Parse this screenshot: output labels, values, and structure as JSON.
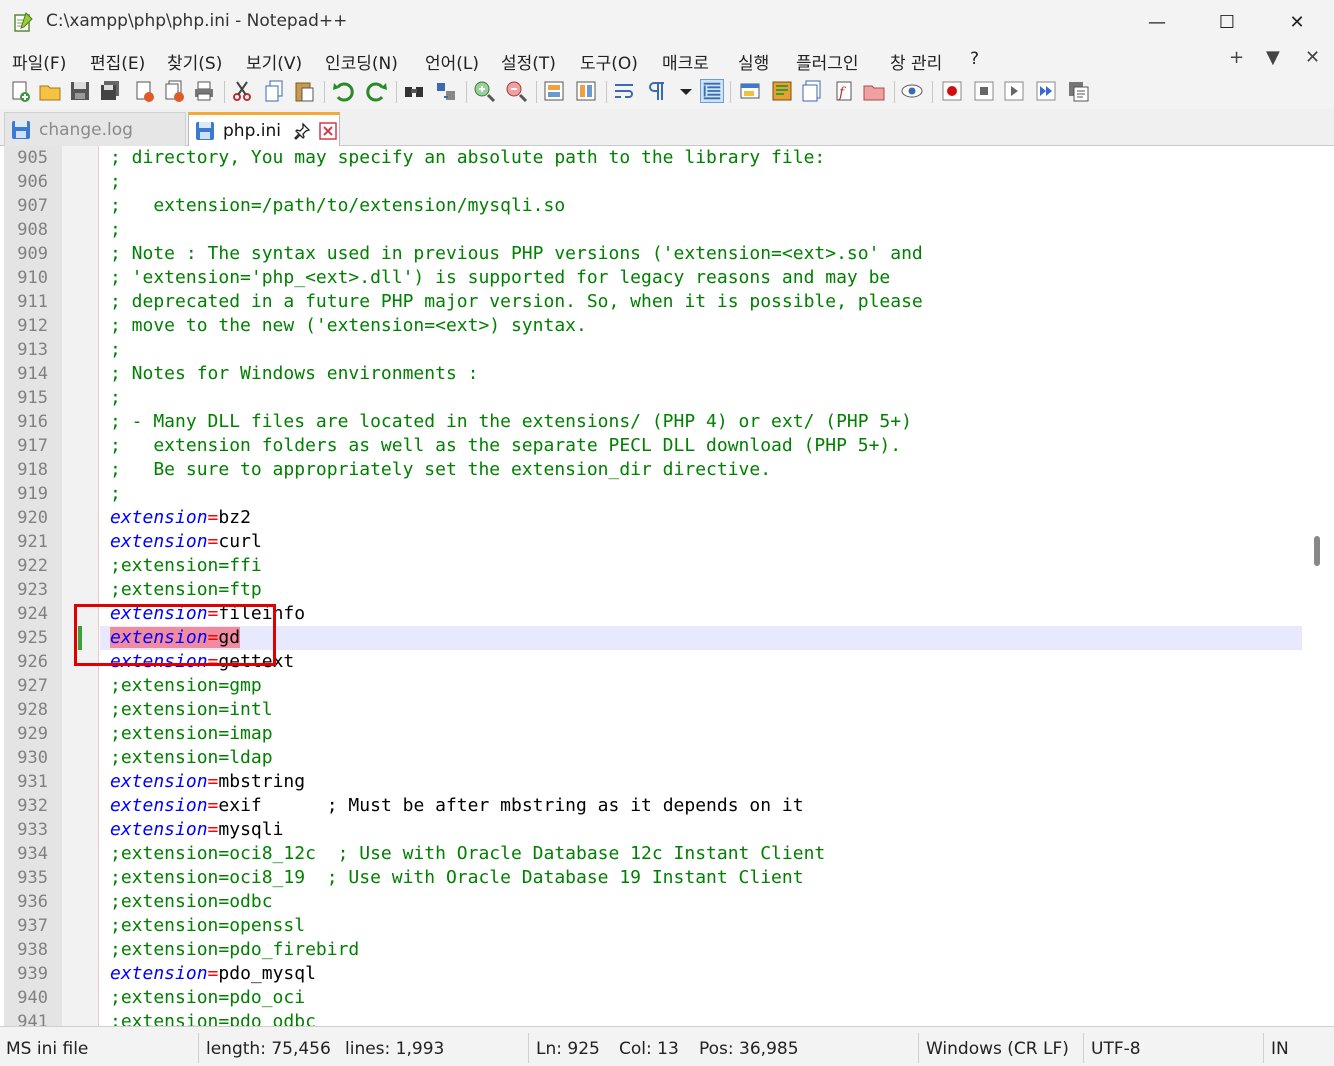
{
  "window": {
    "title": "C:\\xampp\\php\\php.ini - Notepad++",
    "minimize": "—",
    "maximize": "☐",
    "close": "✕"
  },
  "menu": {
    "items": [
      "파일(F)",
      "편집(E)",
      "찾기(S)",
      "보기(V)",
      "인코딩(N)",
      "언어(L)",
      "설정(T)",
      "도구(O)",
      "매크로",
      "실행",
      "플러그인",
      "창 관리",
      "?"
    ],
    "right": [
      "+",
      "▼",
      "✕"
    ]
  },
  "tabs": [
    {
      "label": "change.log",
      "active": false
    },
    {
      "label": "php.ini",
      "active": true,
      "pin": "📌",
      "close": "✕"
    }
  ],
  "editor": {
    "current_line": "925",
    "lines": [
      {
        "n": "905",
        "parts": [
          {
            "t": "; directory, You may specify an absolute path to the library file:",
            "k": "comment"
          }
        ]
      },
      {
        "n": "906",
        "parts": [
          {
            "t": ";",
            "k": "comment"
          }
        ]
      },
      {
        "n": "907",
        "parts": [
          {
            "t": ";   extension=/path/to/extension/mysqli.so",
            "k": "comment"
          }
        ]
      },
      {
        "n": "908",
        "parts": [
          {
            "t": ";",
            "k": "comment"
          }
        ]
      },
      {
        "n": "909",
        "parts": [
          {
            "t": "; Note : The syntax used in previous PHP versions ('extension=<ext>.so' and",
            "k": "comment"
          }
        ]
      },
      {
        "n": "910",
        "parts": [
          {
            "t": "; 'extension='php_<ext>.dll') is supported for legacy reasons and may be",
            "k": "comment"
          }
        ]
      },
      {
        "n": "911",
        "parts": [
          {
            "t": "; deprecated in a future PHP major version. So, when it is possible, please",
            "k": "comment"
          }
        ]
      },
      {
        "n": "912",
        "parts": [
          {
            "t": "; move to the new ('extension=<ext>) syntax.",
            "k": "comment"
          }
        ]
      },
      {
        "n": "913",
        "parts": [
          {
            "t": ";",
            "k": "comment"
          }
        ]
      },
      {
        "n": "914",
        "parts": [
          {
            "t": "; Notes for Windows environments :",
            "k": "comment"
          }
        ]
      },
      {
        "n": "915",
        "parts": [
          {
            "t": ";",
            "k": "comment"
          }
        ]
      },
      {
        "n": "916",
        "parts": [
          {
            "t": "; - Many DLL files are located in the extensions/ (PHP 4) or ext/ (PHP 5+)",
            "k": "comment"
          }
        ]
      },
      {
        "n": "917",
        "parts": [
          {
            "t": ";   extension folders as well as the separate PECL DLL download (PHP 5+).",
            "k": "comment"
          }
        ]
      },
      {
        "n": "918",
        "parts": [
          {
            "t": ";   Be sure to appropriately set the extension_dir directive.",
            "k": "comment"
          }
        ]
      },
      {
        "n": "919",
        "parts": [
          {
            "t": ";",
            "k": "comment"
          }
        ]
      },
      {
        "n": "920",
        "parts": [
          {
            "t": "extension",
            "k": "key"
          },
          {
            "t": "=",
            "k": "eq"
          },
          {
            "t": "bz2",
            "k": "val"
          }
        ]
      },
      {
        "n": "921",
        "parts": [
          {
            "t": "extension",
            "k": "key"
          },
          {
            "t": "=",
            "k": "eq"
          },
          {
            "t": "curl",
            "k": "val"
          }
        ]
      },
      {
        "n": "922",
        "parts": [
          {
            "t": ";extension=ffi",
            "k": "comment"
          }
        ]
      },
      {
        "n": "923",
        "parts": [
          {
            "t": ";extension=ftp",
            "k": "comment"
          }
        ]
      },
      {
        "n": "924",
        "parts": [
          {
            "t": "extension",
            "k": "key"
          },
          {
            "t": "=",
            "k": "eq"
          },
          {
            "t": "fileinfo",
            "k": "val"
          }
        ]
      },
      {
        "n": "925",
        "parts": [
          {
            "t": "extension",
            "k": "key"
          },
          {
            "t": "=",
            "k": "eq"
          },
          {
            "t": "gd",
            "k": "val"
          }
        ],
        "selected": true
      },
      {
        "n": "926",
        "parts": [
          {
            "t": "extension",
            "k": "key"
          },
          {
            "t": "=",
            "k": "eq"
          },
          {
            "t": "gettext",
            "k": "val"
          }
        ]
      },
      {
        "n": "927",
        "parts": [
          {
            "t": ";extension=gmp",
            "k": "comment"
          }
        ]
      },
      {
        "n": "928",
        "parts": [
          {
            "t": ";extension=intl",
            "k": "comment"
          }
        ]
      },
      {
        "n": "929",
        "parts": [
          {
            "t": ";extension=imap",
            "k": "comment"
          }
        ]
      },
      {
        "n": "930",
        "parts": [
          {
            "t": ";extension=ldap",
            "k": "comment"
          }
        ]
      },
      {
        "n": "931",
        "parts": [
          {
            "t": "extension",
            "k": "key"
          },
          {
            "t": "=",
            "k": "eq"
          },
          {
            "t": "mbstring",
            "k": "val"
          }
        ]
      },
      {
        "n": "932",
        "parts": [
          {
            "t": "extension",
            "k": "key"
          },
          {
            "t": "=",
            "k": "eq"
          },
          {
            "t": "exif      ; Must be after mbstring as it depends on it",
            "k": "val"
          }
        ]
      },
      {
        "n": "933",
        "parts": [
          {
            "t": "extension",
            "k": "key"
          },
          {
            "t": "=",
            "k": "eq"
          },
          {
            "t": "mysqli",
            "k": "val"
          }
        ]
      },
      {
        "n": "934",
        "parts": [
          {
            "t": ";extension=oci8_12c  ; Use with Oracle Database 12c Instant Client",
            "k": "comment"
          }
        ]
      },
      {
        "n": "935",
        "parts": [
          {
            "t": ";extension=oci8_19  ; Use with Oracle Database 19 Instant Client",
            "k": "comment"
          }
        ]
      },
      {
        "n": "936",
        "parts": [
          {
            "t": ";extension=odbc",
            "k": "comment"
          }
        ]
      },
      {
        "n": "937",
        "parts": [
          {
            "t": ";extension=openssl",
            "k": "comment"
          }
        ]
      },
      {
        "n": "938",
        "parts": [
          {
            "t": ";extension=pdo_firebird",
            "k": "comment"
          }
        ]
      },
      {
        "n": "939",
        "parts": [
          {
            "t": "extension",
            "k": "key"
          },
          {
            "t": "=",
            "k": "eq"
          },
          {
            "t": "pdo_mysql",
            "k": "val"
          }
        ]
      },
      {
        "n": "940",
        "parts": [
          {
            "t": ";extension=pdo_oci",
            "k": "comment"
          }
        ]
      },
      {
        "n": "941",
        "parts": [
          {
            "t": ";extension=pdo_odbc",
            "k": "comment"
          }
        ]
      }
    ]
  },
  "status": {
    "file_type": "MS ini file",
    "length": "length: 75,456",
    "lines": "lines: 1,993",
    "ln": "Ln: 925",
    "col": "Col: 13",
    "pos": "Pos: 36,985",
    "eol": "Windows (CR LF)",
    "encoding": "UTF-8",
    "mode": "IN"
  },
  "colors": {
    "comment": "#008000",
    "key": "#0000ff",
    "eq": "#ff0000",
    "current_line": "#e8e8ff",
    "selection": "#f08ca0",
    "annotation_box": "#e00000",
    "tab_accent": "#f7a736"
  }
}
